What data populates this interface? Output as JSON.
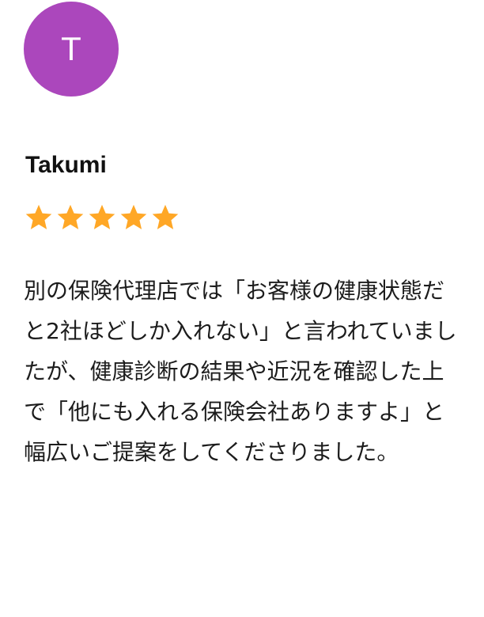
{
  "review": {
    "avatar": {
      "initial": "T",
      "color": "#ab47bc"
    },
    "author_name": "Takumi",
    "rating": {
      "value": 5,
      "max": 5,
      "star_color": "#ffa726"
    },
    "text": "別の保険代理店では「お客様の健康状態だと2社ほどしか入れない」と言われていましたが、健康診断の結果や近況を確認した上で「他にも入れる保険会社ありますよ」と幅広いご提案をしてくださりました。"
  }
}
